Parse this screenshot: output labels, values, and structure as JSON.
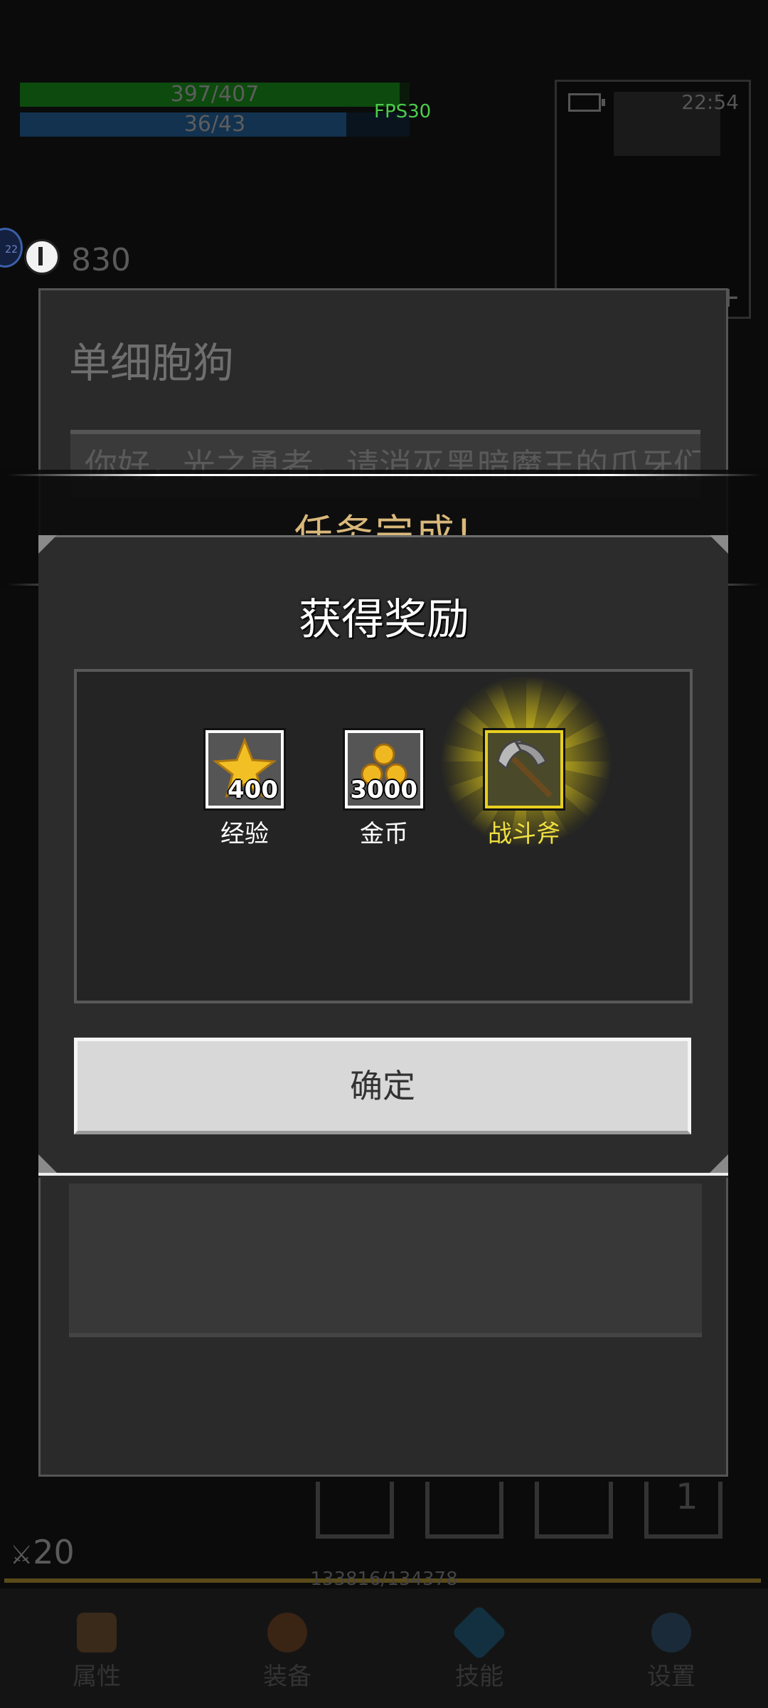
{
  "hud": {
    "hp_text": "397/407",
    "hp_fraction": 0.975,
    "mp_text": "36/43",
    "mp_fraction": 0.837,
    "fps": "FPS30",
    "timer": "830",
    "level_badge": "22"
  },
  "minimap": {
    "time": "22:54",
    "plus": "+"
  },
  "background_dialog": {
    "npc_name": "单细胞狗",
    "speech": "你好，光之勇者，请消灭黑暗魔王的爪牙们，阻止黑暗的"
  },
  "quest_banner": {
    "title": "任务完成!"
  },
  "reward_dialog": {
    "header": "获得奖励",
    "items": [
      {
        "label": "经验",
        "qty": "400",
        "icon": "star-icon"
      },
      {
        "label": "金币",
        "qty": "3000",
        "icon": "gold-coins-icon"
      },
      {
        "label": "战斗斧",
        "qty": "",
        "icon": "battle-axe-icon",
        "highlighted": true
      }
    ],
    "confirm": "确定"
  },
  "bottom_hud": {
    "slot_number": "1",
    "attack": "20",
    "xp_text": "133816/134378",
    "nav": [
      {
        "label": "属性",
        "icon": "helmet-icon"
      },
      {
        "label": "装备",
        "icon": "bag-icon"
      },
      {
        "label": "技能",
        "icon": "skill-gem-icon"
      },
      {
        "label": "设置",
        "icon": "gear-icon"
      }
    ]
  },
  "colors": {
    "hp": "#0d4a0d",
    "mp": "#12324f",
    "banner_title": "#d9b87a",
    "highlight_label": "#f0e040",
    "fps": "#4ccc4c"
  }
}
